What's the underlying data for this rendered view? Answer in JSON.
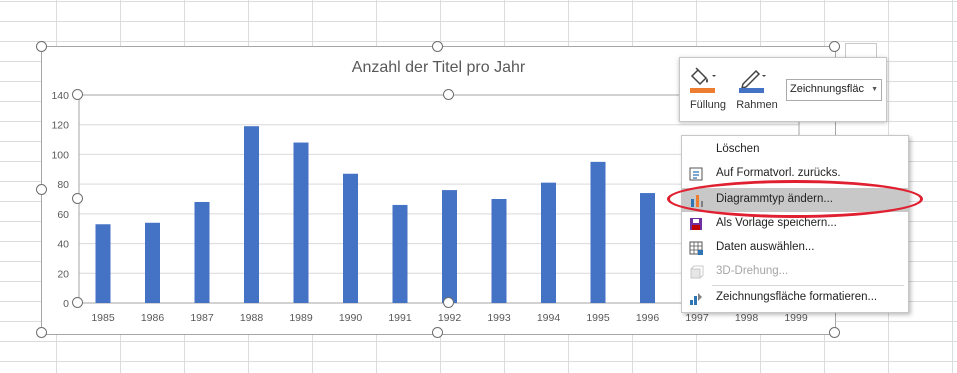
{
  "chart_data": {
    "type": "bar",
    "title": "Anzahl der Titel pro Jahr",
    "categories": [
      "1985",
      "1986",
      "1987",
      "1988",
      "1989",
      "1990",
      "1991",
      "1992",
      "1993",
      "1994",
      "1995",
      "1996",
      "1997",
      "1998",
      "1999"
    ],
    "values": [
      53,
      54,
      68,
      119,
      108,
      87,
      66,
      76,
      70,
      81,
      95,
      74,
      null,
      null,
      null
    ],
    "ylim": [
      0,
      140
    ],
    "yticks": [
      0,
      20,
      40,
      60,
      80,
      100,
      120,
      140
    ],
    "grid": true,
    "bar_color": "#4472c4"
  },
  "toolbar": {
    "fill_label": "Füllung",
    "border_label": "Rahmen",
    "element_select": "Zeichnungsfläc",
    "fill_color": "#ed7d31",
    "border_color": "#4472c4"
  },
  "context_menu": {
    "items": [
      {
        "label": "Löschen",
        "icon": "delete-icon",
        "disabled": false
      },
      {
        "label": "Auf Formatvorl. zurücks.",
        "icon": "reset-style-icon",
        "disabled": false
      },
      {
        "label": "Diagrammtyp ändern...",
        "icon": "chart-type-icon",
        "disabled": false,
        "highlighted": true
      },
      {
        "label": "Als Vorlage speichern...",
        "icon": "save-template-icon",
        "disabled": false
      },
      {
        "label": "Daten auswählen...",
        "icon": "select-data-icon",
        "disabled": false
      },
      {
        "label": "3D-Drehung...",
        "icon": "rotation-3d-icon",
        "disabled": true
      },
      {
        "label": "Zeichnungsfläche formatieren...",
        "icon": "format-plot-area-icon",
        "disabled": false
      }
    ]
  },
  "annotation": {
    "color": "#e02030"
  }
}
